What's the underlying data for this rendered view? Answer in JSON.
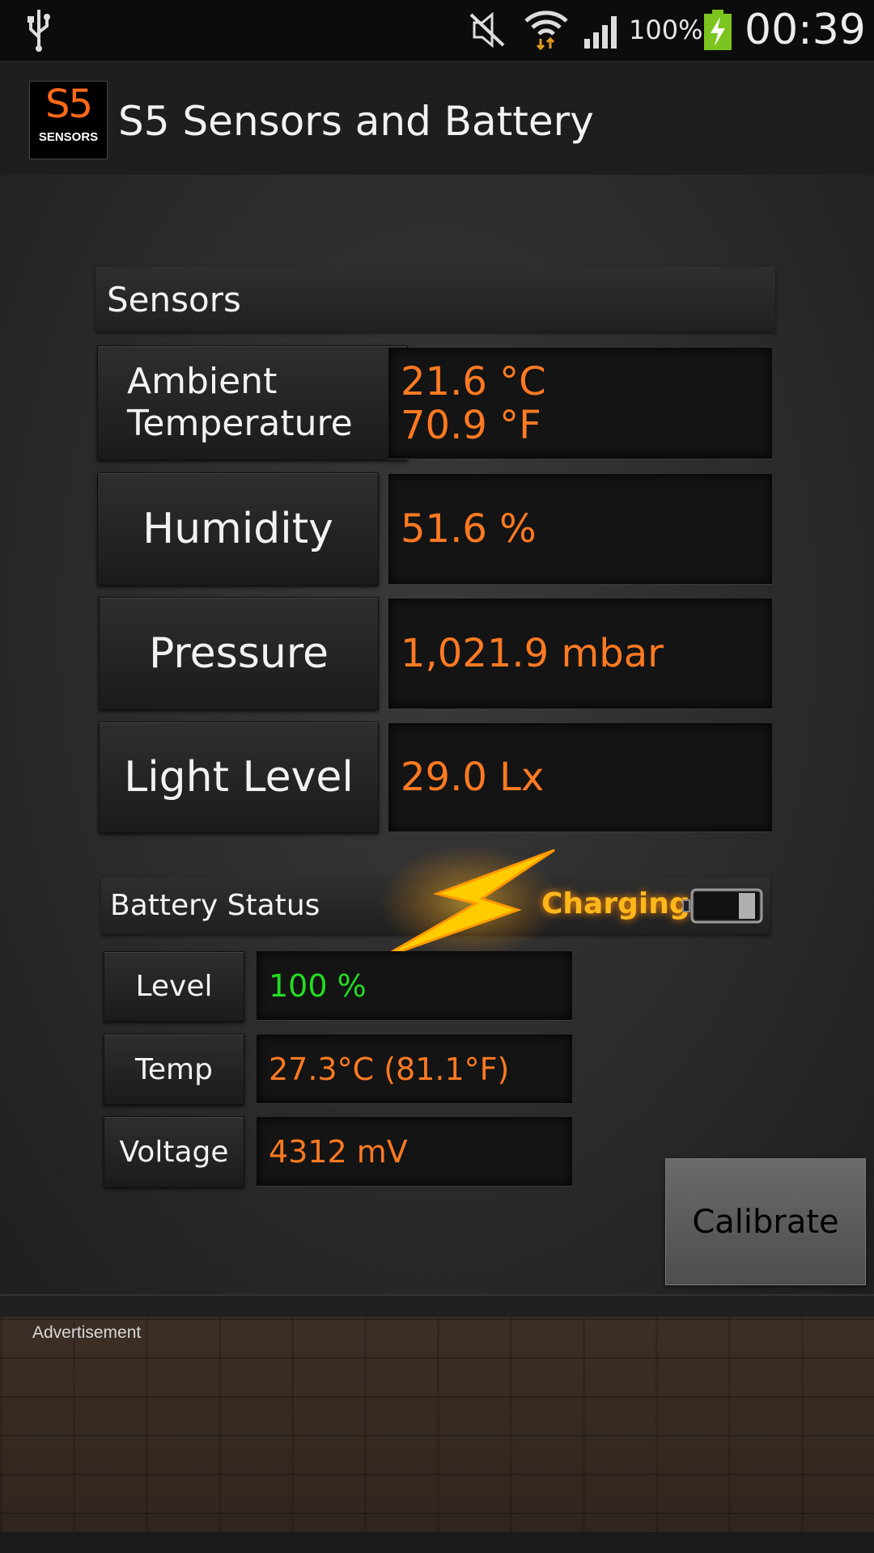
{
  "status_bar": {
    "battery_percent": "100%",
    "time": "00:39",
    "icons": [
      "usb-icon",
      "mute-icon",
      "wifi-icon",
      "signal-icon",
      "battery-charging-icon"
    ]
  },
  "action_bar": {
    "logo_big": "S5",
    "logo_small": "SENSORS",
    "title": "S5 Sensors and Battery"
  },
  "sensors": {
    "header": "Sensors",
    "rows": [
      {
        "label": "Ambient Temperature",
        "value_line1": "21.6 °C",
        "value_line2": "70.9 °F"
      },
      {
        "label": "Humidity",
        "value": "51.6 %"
      },
      {
        "label": "Pressure",
        "value": "1,021.9 mbar"
      },
      {
        "label": "Light Level",
        "value": "29.0 Lx"
      }
    ]
  },
  "battery": {
    "header": "Battery Status",
    "state": "Charging",
    "level_fraction": 1.0,
    "rows": [
      {
        "label": "Level",
        "value": "100 %"
      },
      {
        "label": "Temp",
        "value": "27.3°C (81.1°F)"
      },
      {
        "label": "Voltage",
        "value": "4312 mV"
      }
    ]
  },
  "calibrate_label": "Calibrate",
  "ad_label": "Advertisement",
  "colors": {
    "value_orange": "#ff7a22",
    "level_green": "#22dd22",
    "charging_yellow": "#ffb81c"
  }
}
